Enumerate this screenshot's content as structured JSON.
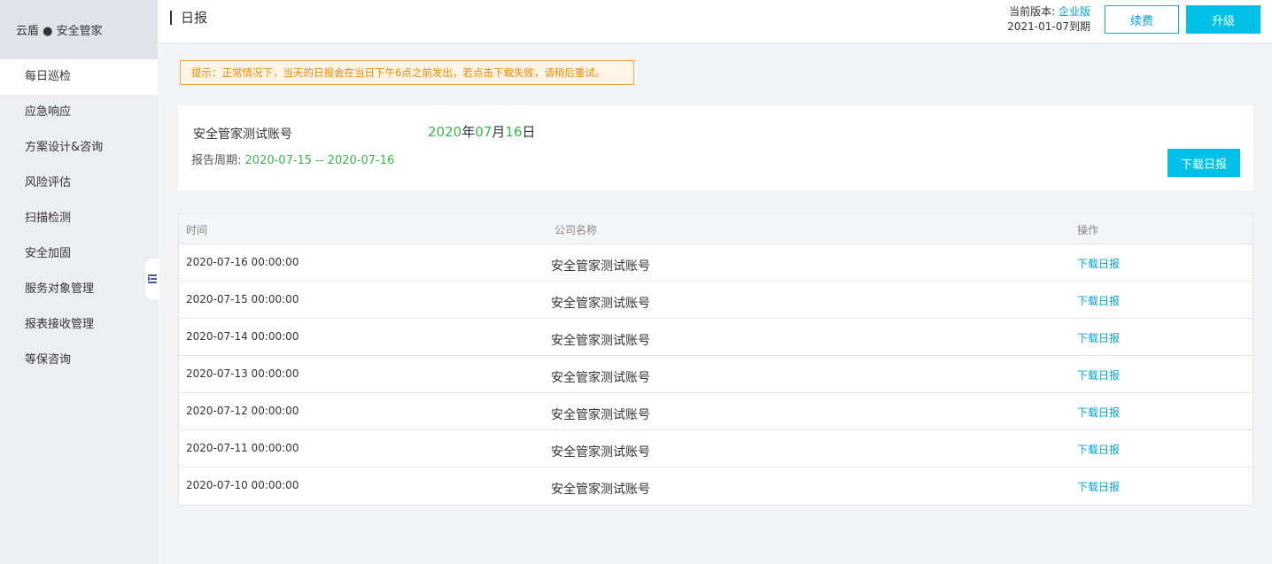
{
  "brand": "云盾 ● 安全管家",
  "sidebar": {
    "items": [
      {
        "label": "每日巡检"
      },
      {
        "label": "应急响应"
      },
      {
        "label": "方案设计&咨询"
      },
      {
        "label": "风险评估"
      },
      {
        "label": "扫描检测"
      },
      {
        "label": "安全加固"
      },
      {
        "label": "服务对象管理"
      },
      {
        "label": "报表接收管理"
      },
      {
        "label": "等保咨询"
      }
    ]
  },
  "header": {
    "title": "日报",
    "version_label": "当前版本:",
    "edition": "企业版",
    "expiry": "2021-01-07到期",
    "renew_label": "续费",
    "upgrade_label": "升级"
  },
  "notice": "提示：正常情况下，当天的日报会在当日下午6点之前发出，若点击下载失败，请稍后重试。",
  "summary": {
    "account": "安全管家测试账号",
    "date": {
      "year": "2020",
      "year_unit": "年",
      "month": "07",
      "month_unit": "月",
      "day": "16",
      "day_unit": "日"
    },
    "period_label": "报告周期:",
    "period_value": "2020-07-15 -- 2020-07-16",
    "download_label": "下载日报"
  },
  "table": {
    "columns": [
      "时间",
      "公司名称",
      "操作"
    ],
    "rows": [
      {
        "time": "2020-07-16 00:00:00",
        "company": "安全管家测试账号",
        "action": "下载日报"
      },
      {
        "time": "2020-07-15 00:00:00",
        "company": "安全管家测试账号",
        "action": "下载日报"
      },
      {
        "time": "2020-07-14 00:00:00",
        "company": "安全管家测试账号",
        "action": "下载日报"
      },
      {
        "time": "2020-07-13 00:00:00",
        "company": "安全管家测试账号",
        "action": "下载日报"
      },
      {
        "time": "2020-07-12 00:00:00",
        "company": "安全管家测试账号",
        "action": "下载日报"
      },
      {
        "time": "2020-07-11 00:00:00",
        "company": "安全管家测试账号",
        "action": "下载日报"
      },
      {
        "time": "2020-07-10 00:00:00",
        "company": "安全管家测试账号",
        "action": "下载日报"
      }
    ]
  },
  "icons": {
    "collapse": "collapse-sidebar-icon"
  },
  "colors": {
    "accent": "#00c1e8",
    "link": "#00a4d8",
    "green": "#39b54a",
    "warning": "#f08a00"
  }
}
